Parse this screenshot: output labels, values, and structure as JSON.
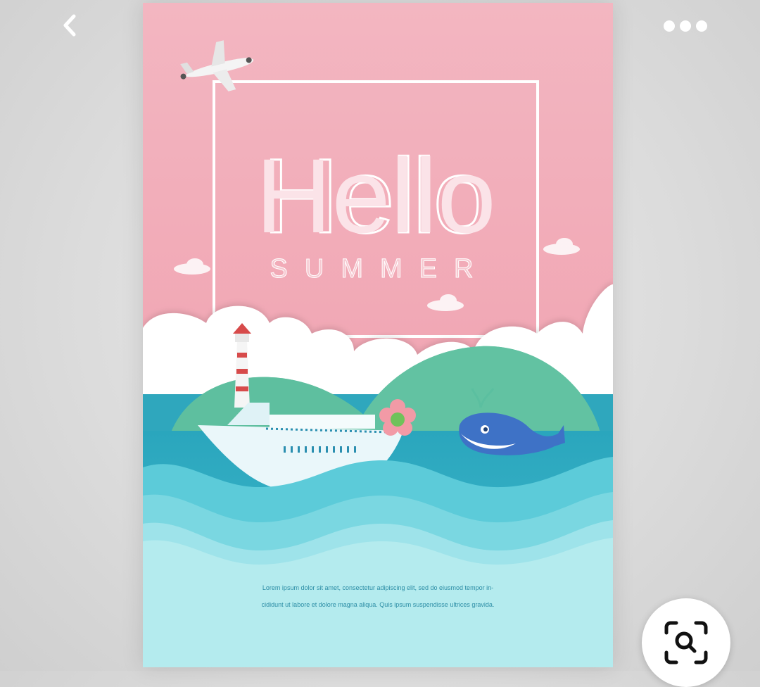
{
  "toolbar": {
    "back_icon": "chevron-left-icon",
    "more_icon": "more-horizontal-icon"
  },
  "poster": {
    "headline": "Hello",
    "subheadline": "SUMMER",
    "body_line_1": "Lorem ipsum dolor sit amet, consectetur adipiscing elit, sed do eiusmod tempor in-",
    "body_line_2": "cididunt ut labore et dolore magna aliqua. Quis ipsum suspendisse ultrices gravida.",
    "colors": {
      "sky_pink": "#f1b8c3",
      "cloud": "#ffffff",
      "hill_green": "#5fbfa0",
      "sea_teal": "#3ab3c0",
      "wave_light": "#8fdde6",
      "bottom_aqua": "#b3ebee",
      "whale_blue": "#3f74c9"
    }
  },
  "lens_button": {
    "icon": "visual-search-icon"
  }
}
